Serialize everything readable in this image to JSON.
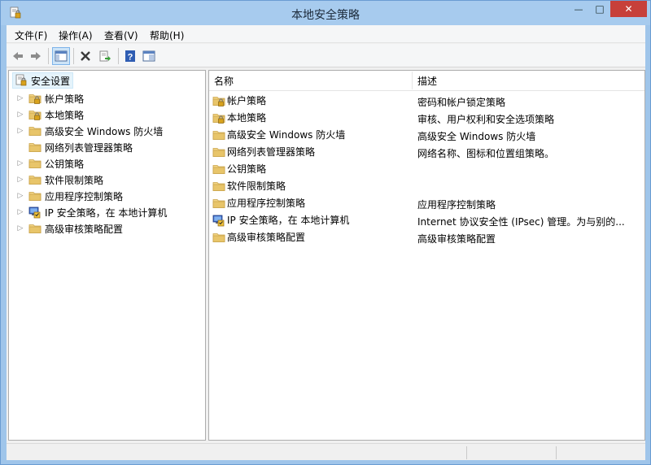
{
  "window": {
    "title": "本地安全策略",
    "min_glyph": "—",
    "max_glyph": "□",
    "close_glyph": "✕"
  },
  "menu": [
    "文件(F)",
    "操作(A)",
    "查看(V)",
    "帮助(H)"
  ],
  "toolbar": {
    "buttons": [
      "back-icon",
      "forward-icon",
      "show-tree-icon",
      "delete-icon",
      "export-list-icon",
      "help-icon",
      "properties-icon"
    ]
  },
  "tree": {
    "root": "安全设置",
    "items": [
      {
        "label": "帐户策略",
        "icon": "folder-lock-icon",
        "expandable": true
      },
      {
        "label": "本地策略",
        "icon": "folder-lock-icon",
        "expandable": true
      },
      {
        "label": "高级安全 Windows 防火墙",
        "icon": "folder-icon",
        "expandable": true
      },
      {
        "label": "网络列表管理器策略",
        "icon": "folder-icon",
        "expandable": false
      },
      {
        "label": "公钥策略",
        "icon": "folder-icon",
        "expandable": true
      },
      {
        "label": "软件限制策略",
        "icon": "folder-icon",
        "expandable": true
      },
      {
        "label": "应用程序控制策略",
        "icon": "folder-icon",
        "expandable": true
      },
      {
        "label": "IP 安全策略，在 本地计算机",
        "icon": "ip-security-icon",
        "expandable": true
      },
      {
        "label": "高级审核策略配置",
        "icon": "folder-icon",
        "expandable": true
      }
    ]
  },
  "list": {
    "columns": [
      "名称",
      "描述"
    ],
    "rows": [
      {
        "name": "帐户策略",
        "desc": "密码和帐户锁定策略",
        "icon": "folder-lock-icon"
      },
      {
        "name": "本地策略",
        "desc": "审核、用户权利和安全选项策略",
        "icon": "folder-lock-icon"
      },
      {
        "name": "高级安全 Windows 防火墙",
        "desc": "高级安全 Windows 防火墙",
        "icon": "folder-icon"
      },
      {
        "name": "网络列表管理器策略",
        "desc": "网络名称、图标和位置组策略。",
        "icon": "folder-icon"
      },
      {
        "name": "公钥策略",
        "desc": "",
        "icon": "folder-icon"
      },
      {
        "name": "软件限制策略",
        "desc": "",
        "icon": "folder-icon"
      },
      {
        "name": "应用程序控制策略",
        "desc": "应用程序控制策略",
        "icon": "folder-icon"
      },
      {
        "name": "IP 安全策略，在 本地计算机",
        "desc": "Internet 协议安全性 (IPsec) 管理。为与别的...",
        "icon": "ip-security-icon"
      },
      {
        "name": "高级审核策略配置",
        "desc": "高级审核策略配置",
        "icon": "folder-icon"
      }
    ]
  },
  "colors": {
    "titlebar": "#a7cbee",
    "close": "#c7403a",
    "selection": "#e5f3fb",
    "folder": "#e8c56a"
  }
}
